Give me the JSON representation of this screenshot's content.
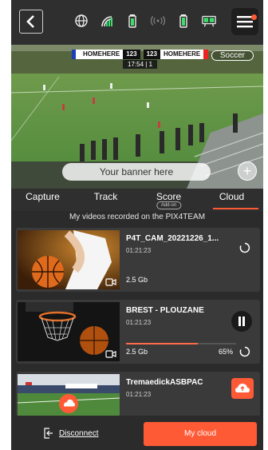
{
  "topbar": {
    "icons": [
      "back-icon",
      "globe-icon",
      "signal-icon",
      "battery-icon",
      "broadcast-icon",
      "phone-battery-icon",
      "scoreboard-icon",
      "menu-icon"
    ]
  },
  "video": {
    "team_left": "HOMEHERE",
    "score_left": "123",
    "score_right": "123",
    "team_right": "HOMEHERE",
    "clock": "17:54",
    "period": "1",
    "sport": "Soccer",
    "banner_text": "Your banner here"
  },
  "tabs": [
    {
      "label": "Capture"
    },
    {
      "label": "Track"
    },
    {
      "label": "Score",
      "badge": "Add-on"
    },
    {
      "label": "Cloud",
      "active": true
    }
  ],
  "section_title": "My videos recorded on the PIX4TEAM",
  "videos": [
    {
      "title": "P4T_CAM_20221226_1...",
      "duration": "01:21:23",
      "size": "2.5 Gb"
    },
    {
      "title": "BREST - PLOUZANE",
      "duration": "01:21:23",
      "size": "2.5 Gb",
      "progress_percent": 65,
      "progress_label": "65%"
    },
    {
      "title": "TremaedickASBPAC",
      "duration": "01:21:23"
    }
  ],
  "bottom": {
    "disconnect_label": "Disconnect",
    "mycloud_label": "My cloud"
  },
  "colors": {
    "accent": "#ff5a36",
    "background": "#2b2b2b",
    "card": "#3a3a3a"
  }
}
